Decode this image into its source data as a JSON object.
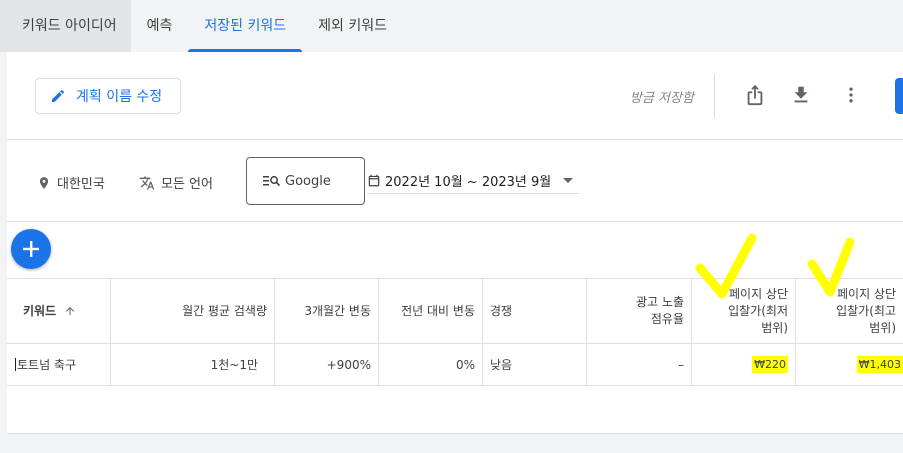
{
  "tabs": [
    "키워드 아이디어",
    "예측",
    "저장된 키워드",
    "제외 키워드"
  ],
  "toolbar": {
    "edit_label": "계획 이름 수정",
    "saved_text": "방금 저장함"
  },
  "filters": {
    "location": "대한민국",
    "language": "모든 언어",
    "network": "Google",
    "date_range": "2022년 10월 ~ 2023년 9월"
  },
  "table": {
    "headers": {
      "keyword": "키워드",
      "monthly": "월간 평균 검색량",
      "three_month": "3개월간 변동",
      "yoy": "전년 대비 변동",
      "competition": "경쟁",
      "impression_l1": "광고 노출",
      "impression_l2": "점유율",
      "low_l1": "페이지 상단",
      "low_l2": "입찰가(최저",
      "low_l3": "범위)",
      "high_l1": "페이지 상단",
      "high_l2": "입찰가(최고",
      "high_l3": "범위)"
    },
    "row": {
      "keyword": "토트넘 축구",
      "monthly": "1천~1만",
      "three_month": "+900%",
      "yoy": "0%",
      "competition": "낮음",
      "impression": "–",
      "low_bid": "₩220",
      "high_bid": "₩1,403"
    }
  },
  "colors": {
    "accent": "#1a73e8",
    "highlight": "#ffff00"
  }
}
